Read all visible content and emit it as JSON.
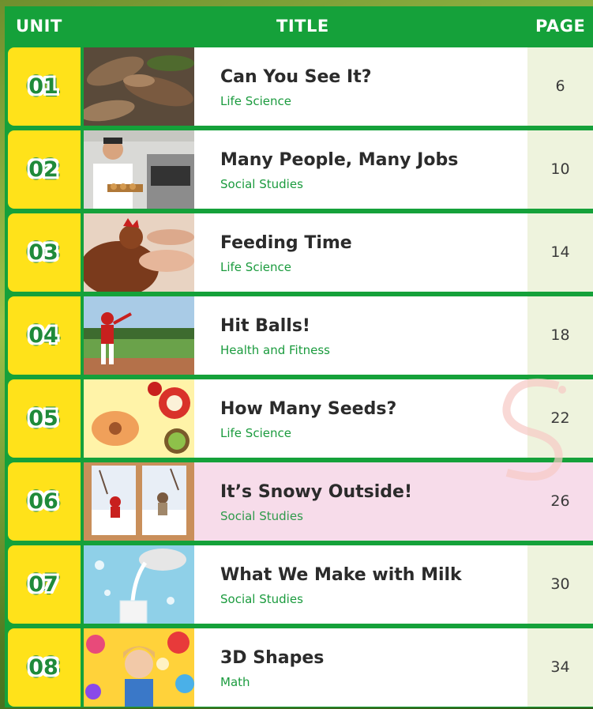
{
  "header": {
    "unit": "UNIT",
    "title": "TITLE",
    "page": "PAGE"
  },
  "units": [
    {
      "number": "01",
      "title": "Can You See It?",
      "subject": "Life Science",
      "page": "6",
      "image": "camouflaged-lizard-on-leaves"
    },
    {
      "number": "02",
      "title": "Many People, Many Jobs",
      "subject": "Social Studies",
      "page": "10",
      "image": "baker-in-kitchen"
    },
    {
      "number": "03",
      "title": "Feeding Time",
      "subject": "Life Science",
      "page": "14",
      "image": "hand-feeding-hen"
    },
    {
      "number": "04",
      "title": "Hit Balls!",
      "subject": "Health and Fitness",
      "page": "18",
      "image": "child-batting-baseball"
    },
    {
      "number": "05",
      "title": "How Many Seeds?",
      "subject": "Life Science",
      "page": "22",
      "image": "cut-fruits-peach-apple-kiwi"
    },
    {
      "number": "06",
      "title": "It’s Snowy Outside!",
      "subject": "Social Studies",
      "page": "26",
      "image": "snowy-window-view"
    },
    {
      "number": "07",
      "title": "What We Make with Milk",
      "subject": "Social Studies",
      "page": "30",
      "image": "milk-pouring-into-glass"
    },
    {
      "number": "08",
      "title": "3D Shapes",
      "subject": "Math",
      "page": "34",
      "image": "girl-with-bubbles"
    }
  ],
  "colors": {
    "header_green": "#15a13a",
    "unit_yellow": "#ffe21a",
    "subject_green": "#1b9b3e",
    "highlight_pink": "#f7dcea",
    "page_cell": "#eef3dd"
  }
}
